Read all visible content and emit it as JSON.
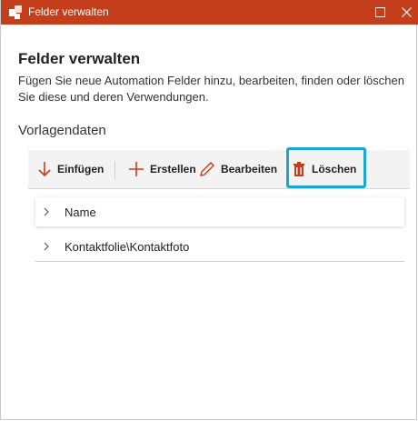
{
  "window": {
    "title": "Felder verwalten",
    "maximize_icon": "maximize-icon",
    "close_icon": "close-icon",
    "accent": "#c43e1c"
  },
  "header": {
    "heading": "Felder verwalten",
    "description": "Fügen Sie neue Automation Felder hinzu, bearbeiten, finden oder löschen Sie diese und deren Verwendungen."
  },
  "section": {
    "label": "Vorlagendaten"
  },
  "toolbar": {
    "insert_label": "Einfügen",
    "create_label": "Erstellen",
    "edit_label": "Bearbeiten",
    "delete_label": "Löschen",
    "highlight_color": "#19a7d1"
  },
  "tree": {
    "items": [
      {
        "label": "Name"
      },
      {
        "label": "Kontaktfolie\\Kontaktfoto"
      }
    ]
  }
}
